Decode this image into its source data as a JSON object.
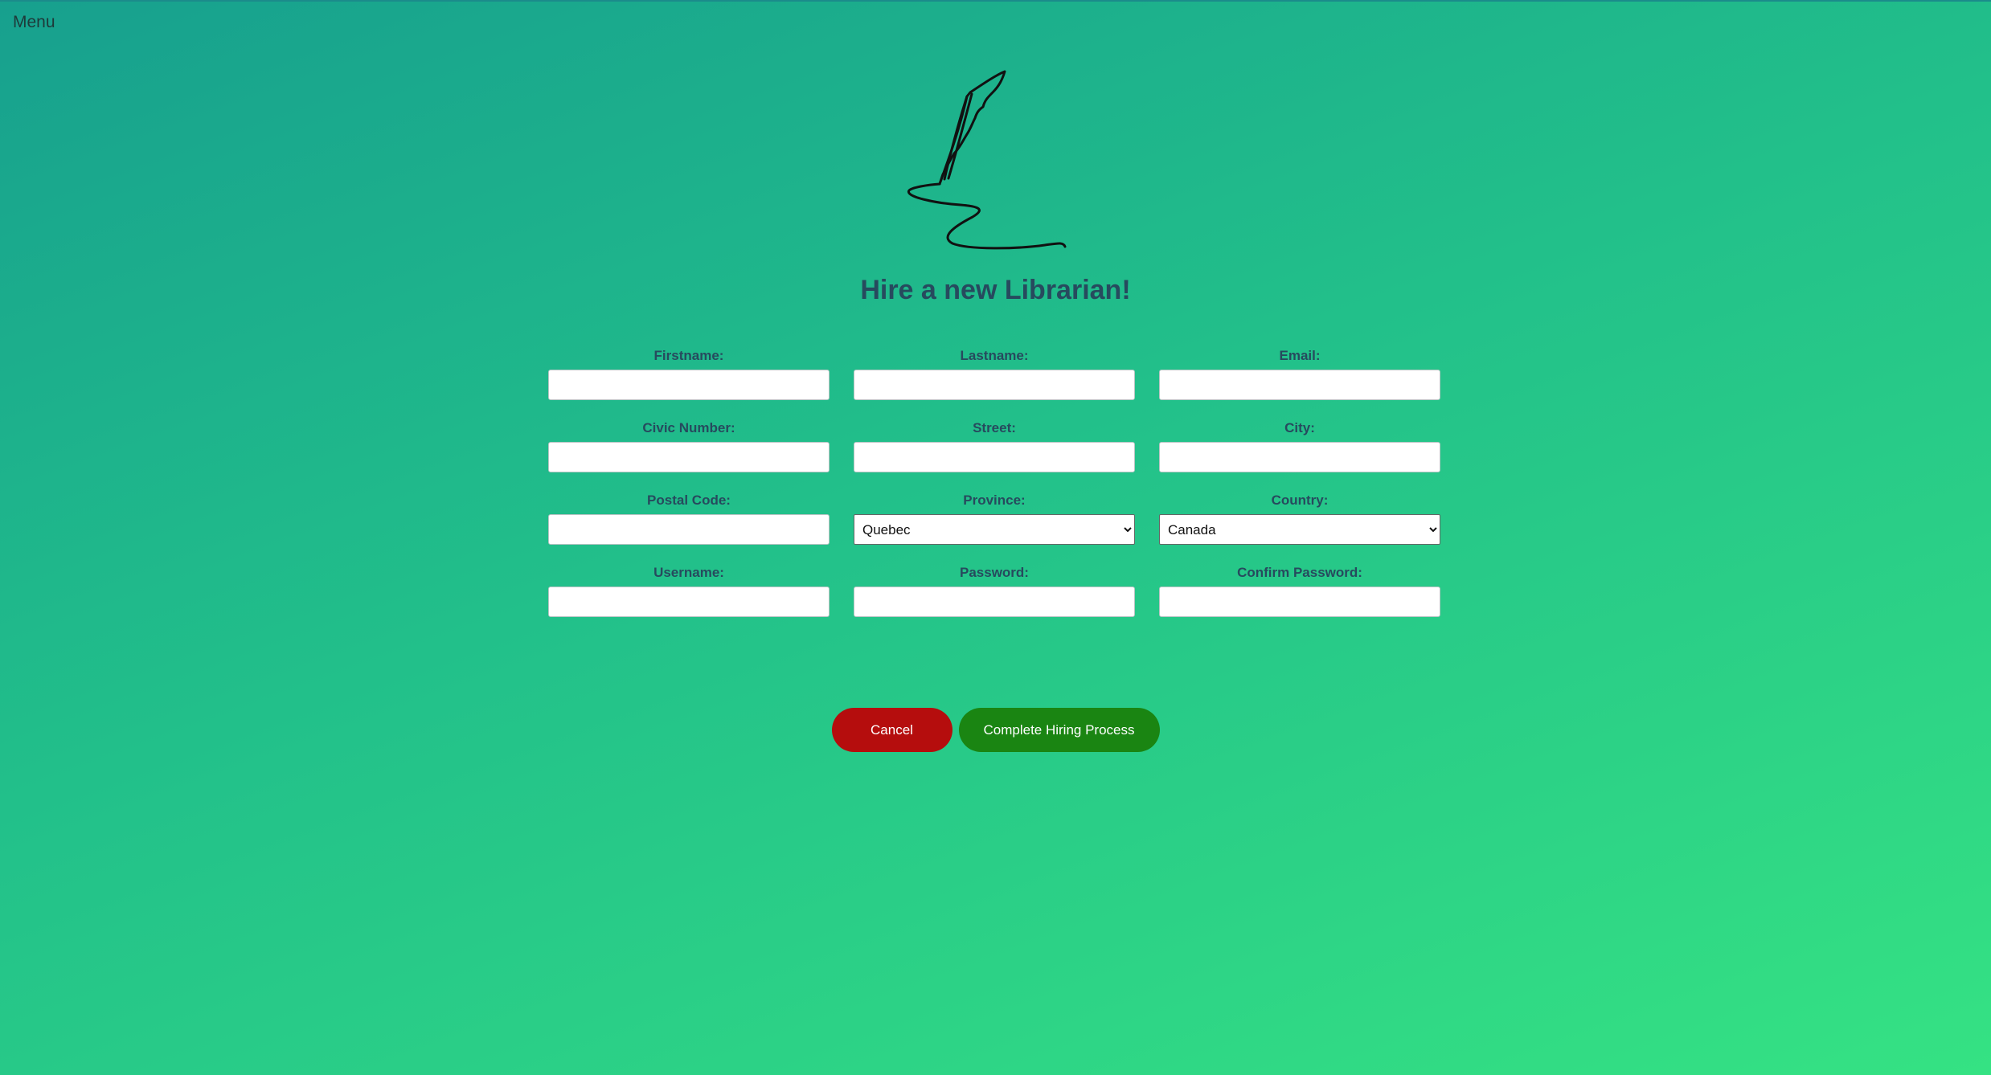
{
  "nav": {
    "menu_label": "Menu"
  },
  "header": {
    "title": "Hire a new Librarian!",
    "logo_icon": "quill-pen-icon"
  },
  "form": {
    "fields": [
      {
        "label": "Firstname:",
        "value": "",
        "type": "text"
      },
      {
        "label": "Lastname:",
        "value": "",
        "type": "text"
      },
      {
        "label": "Email:",
        "value": "",
        "type": "text"
      },
      {
        "label": "Civic Number:",
        "value": "",
        "type": "text"
      },
      {
        "label": "Street:",
        "value": "",
        "type": "text"
      },
      {
        "label": "City:",
        "value": "",
        "type": "text"
      },
      {
        "label": "Postal Code:",
        "value": "",
        "type": "text"
      },
      {
        "label": "Province:",
        "value": "Quebec",
        "type": "select"
      },
      {
        "label": "Country:",
        "value": "Canada",
        "type": "select"
      },
      {
        "label": "Username:",
        "value": "",
        "type": "text"
      },
      {
        "label": "Password:",
        "value": "",
        "type": "password"
      },
      {
        "label": "Confirm Password:",
        "value": "",
        "type": "password"
      }
    ]
  },
  "actions": {
    "cancel_label": "Cancel",
    "complete_label": "Complete Hiring Process"
  },
  "colors": {
    "cancel": "#b50d0d",
    "complete": "#1a8512",
    "title": "#274a5e"
  }
}
